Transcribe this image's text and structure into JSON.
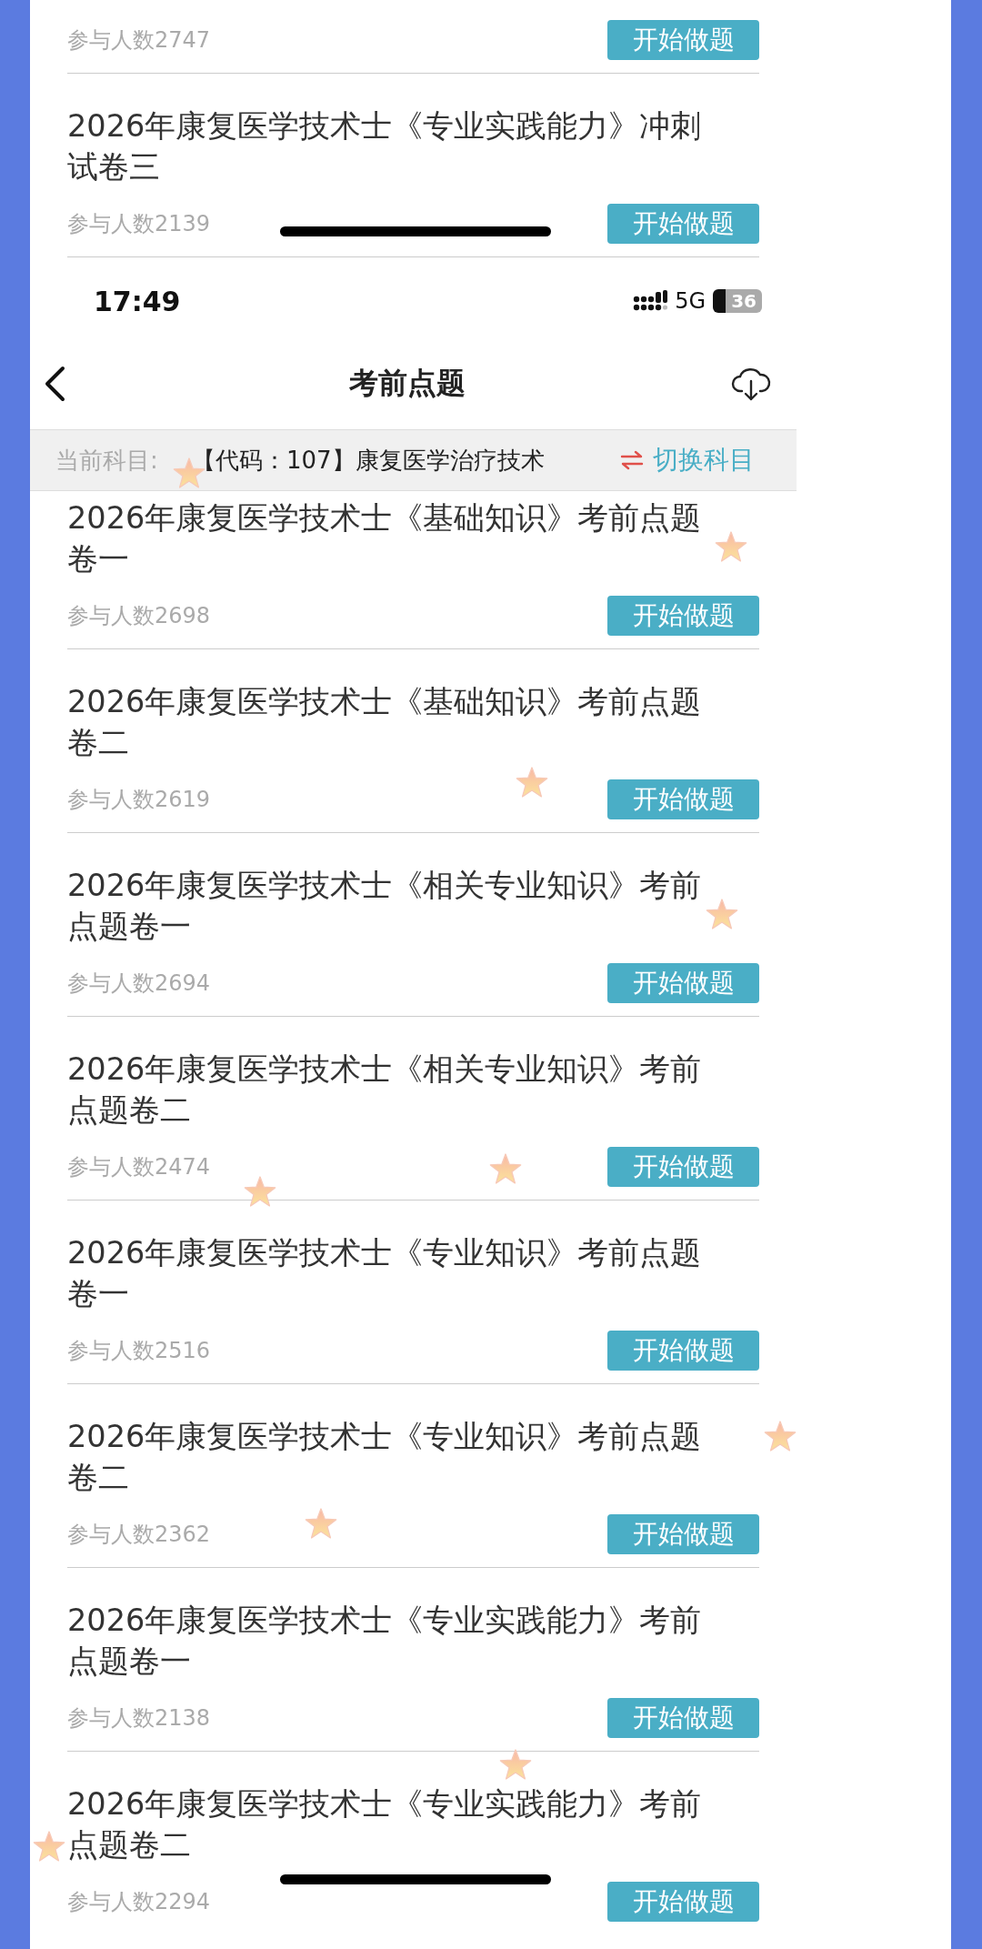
{
  "top_fragment": {
    "items": [
      {
        "count": "参与人数2747",
        "button": "开始做题"
      },
      {
        "title": "2026年康复医学技术士《专业实践能力》冲刺试卷三",
        "count": "参与人数2139",
        "button": "开始做题"
      }
    ]
  },
  "status_bar": {
    "time": "17:49",
    "network": "5G",
    "battery": "36"
  },
  "nav": {
    "title": "考前点题"
  },
  "subject_bar": {
    "label": "当前科目:",
    "subject": "【代码：107】康复医学治疗技术",
    "switch": "切换科目"
  },
  "items": [
    {
      "title": "2026年康复医学技术士《基础知识》考前点题卷一",
      "count": "参与人数2698",
      "button": "开始做题"
    },
    {
      "title": "2026年康复医学技术士《基础知识》考前点题卷二",
      "count": "参与人数2619",
      "button": "开始做题"
    },
    {
      "title": "2026年康复医学技术士《相关专业知识》考前点题卷一",
      "count": "参与人数2694",
      "button": "开始做题"
    },
    {
      "title": "2026年康复医学技术士《相关专业知识》考前点题卷二",
      "count": "参与人数2474",
      "button": "开始做题"
    },
    {
      "title": "2026年康复医学技术士《专业知识》考前点题卷一",
      "count": "参与人数2516",
      "button": "开始做题"
    },
    {
      "title": "2026年康复医学技术士《专业知识》考前点题卷二",
      "count": "参与人数2362",
      "button": "开始做题"
    },
    {
      "title": "2026年康复医学技术士《专业实践能力》考前点题卷一",
      "count": "参与人数2138",
      "button": "开始做题"
    },
    {
      "title": "2026年康复医学技术士《专业实践能力》考前点题卷二",
      "count": "参与人数2294",
      "button": "开始做题"
    }
  ]
}
